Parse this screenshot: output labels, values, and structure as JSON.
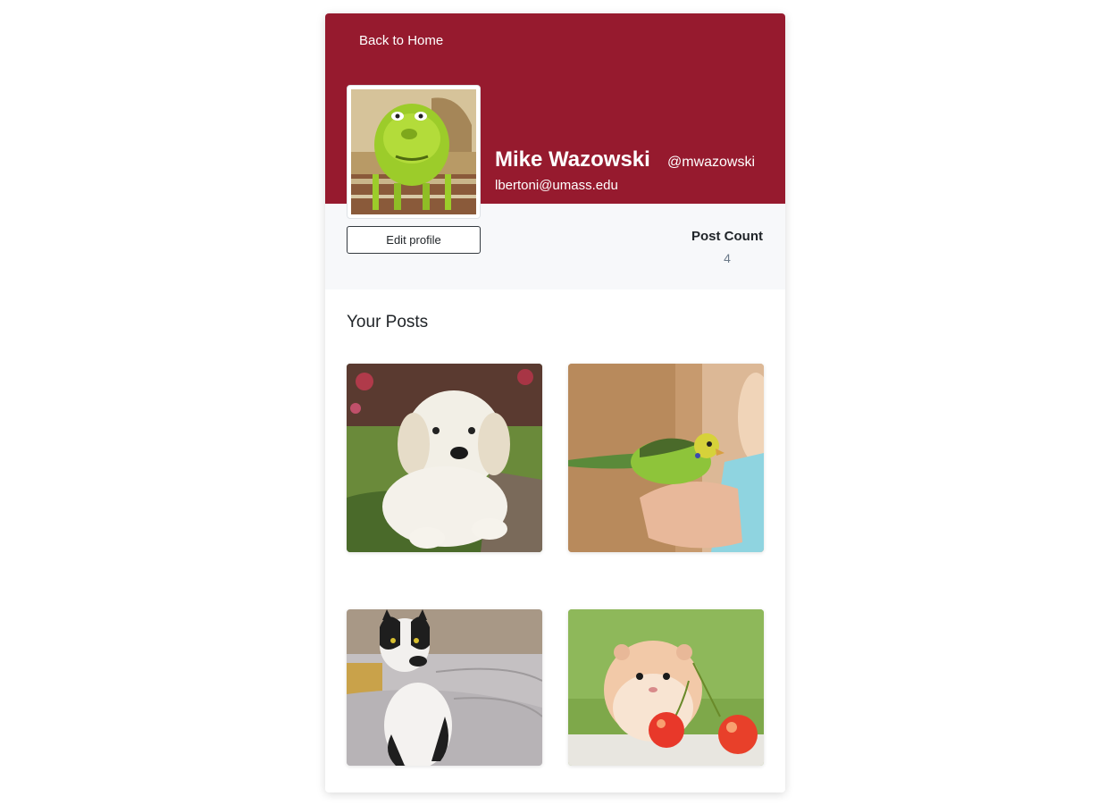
{
  "nav": {
    "back_label": "Back to Home"
  },
  "profile": {
    "name": "Mike Wazowski",
    "handle": "@mwazowski",
    "email": "lbertoni@umass.edu",
    "avatar": "avatar-image",
    "edit_label": "Edit profile"
  },
  "stats": {
    "post_count_label": "Post Count",
    "post_count_value": "4"
  },
  "posts": {
    "title": "Your Posts",
    "items": [
      {
        "image": "golden-retriever-puppy-photo"
      },
      {
        "image": "budgie-on-hand-photo"
      },
      {
        "image": "black-white-cat-photo"
      },
      {
        "image": "hamster-with-cherries-photo"
      }
    ]
  },
  "colors": {
    "banner": "#961a2e",
    "stats_bg": "#f7f8fa",
    "count_value": "#6c7a89"
  }
}
